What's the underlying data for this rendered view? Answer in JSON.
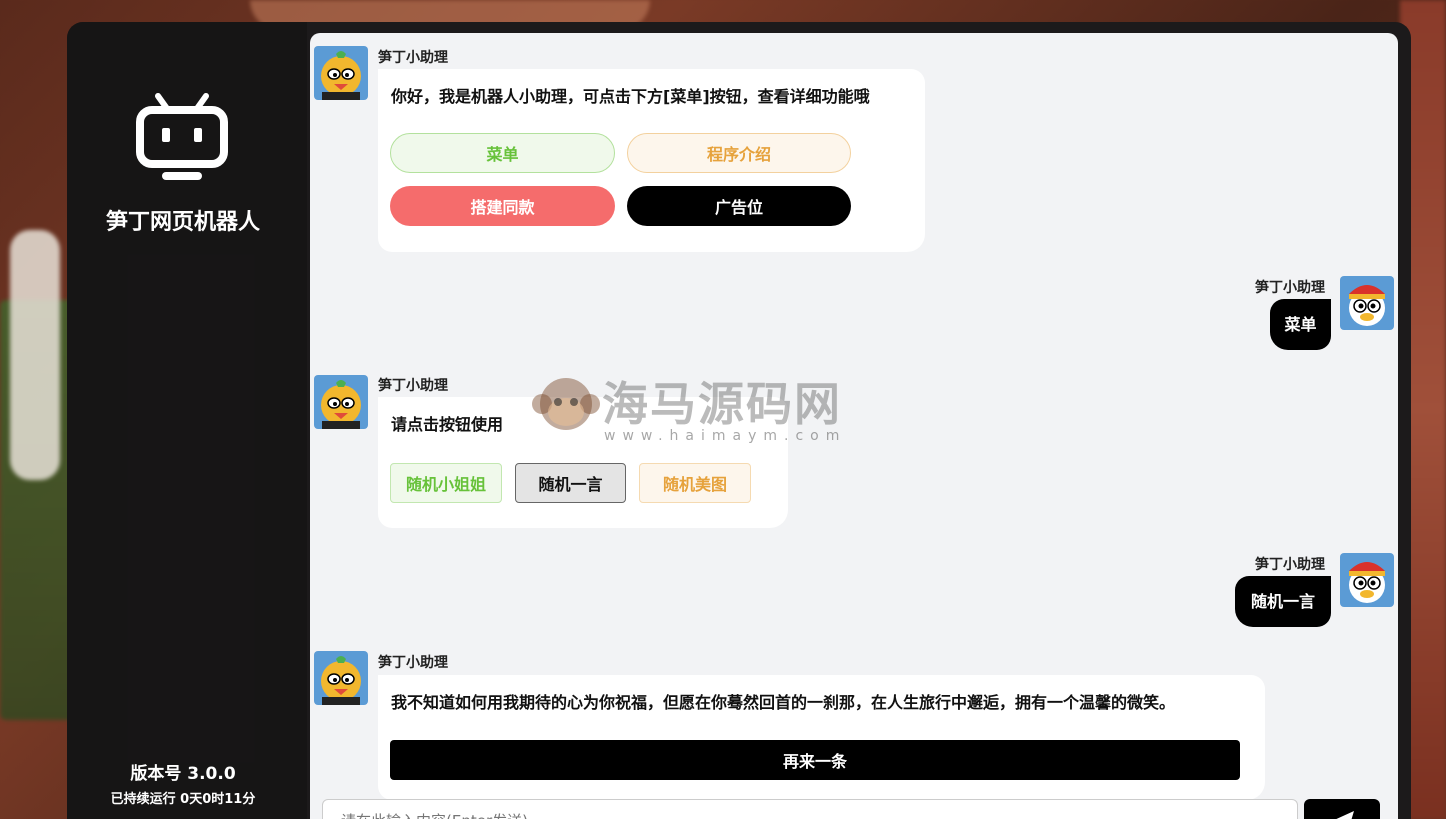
{
  "app": {
    "brand": "笋丁网页机器人",
    "version": "版本号 3.0.0",
    "uptime": "已持续运行 0天0时11分"
  },
  "messages": {
    "m1": {
      "sender": "笋丁小助理",
      "text": "你好，我是机器人小助理，可点击下方[菜单]按钮，查看详细功能哦",
      "buttons": [
        "菜单",
        "程序介绍",
        "搭建同款",
        "广告位"
      ]
    },
    "m2": {
      "sender": "笋丁小助理",
      "text": "菜单"
    },
    "m3": {
      "sender": "笋丁小助理",
      "text": "请点击按钮使用",
      "buttons": [
        "随机小姐姐",
        "随机一言",
        "随机美图"
      ]
    },
    "m4": {
      "sender": "笋丁小助理",
      "text": "随机一言"
    },
    "m5": {
      "sender": "笋丁小助理",
      "text": "我不知道如何用我期待的心为你祝福，但愿在你蓦然回首的一刹那，在人生旅行中邂逅，拥有一个温馨的微笑。",
      "button": "再来一条"
    }
  },
  "watermark": {
    "name": "海马源码网",
    "url": "www.haimaym.com"
  },
  "input": {
    "placeholder": "请在此输入内容(Enter发送)"
  },
  "colors": {
    "green": "#6abf4b",
    "orange": "#e6a23c",
    "red": "#f56c6c",
    "black": "#000000",
    "chat_bg": "#f2f3f5"
  }
}
